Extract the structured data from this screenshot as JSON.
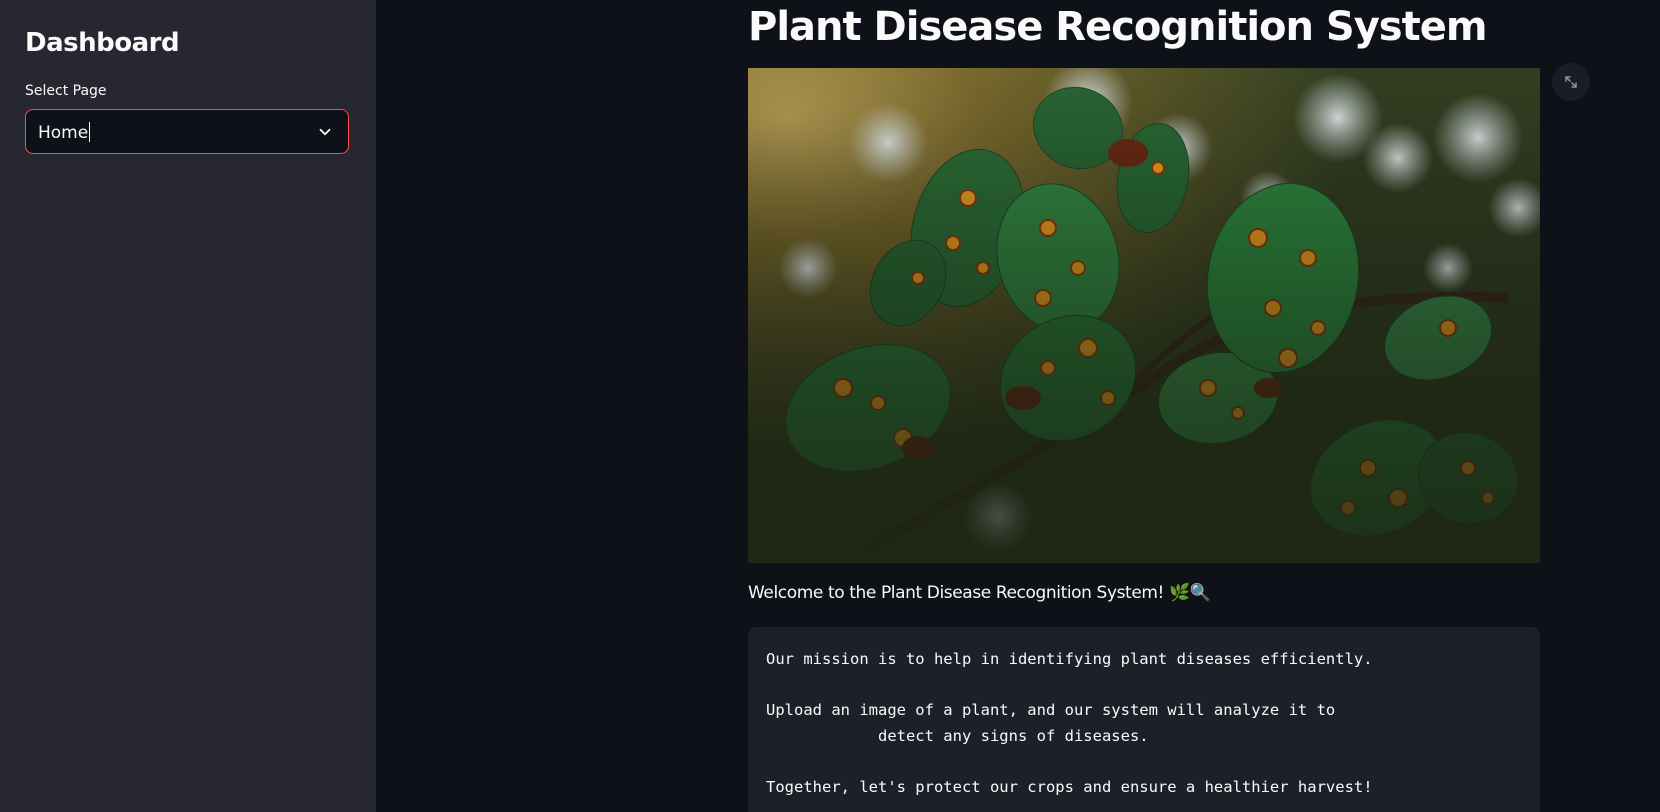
{
  "sidebar": {
    "title": "Dashboard",
    "select_label": "Select Page",
    "select_value": "Home"
  },
  "main": {
    "title": "Plant Disease Recognition System",
    "welcome": "Welcome to the Plant Disease Recognition System! 🌿🔍",
    "mission_text": "Our mission is to help in identifying plant diseases efficiently.\n\nUpload an image of a plant, and our system will analyze it to\n            detect any signs of diseases.\n\nTogether, let's protect our crops and ensure a healthier harvest!"
  },
  "colors": {
    "background": "#0e1117",
    "sidebar": "#262730",
    "accent": "#ff4b4b",
    "code_bg": "#1e2029"
  },
  "icons": {
    "select_chevron": "chevron-down-icon",
    "fullscreen": "expand-icon"
  }
}
